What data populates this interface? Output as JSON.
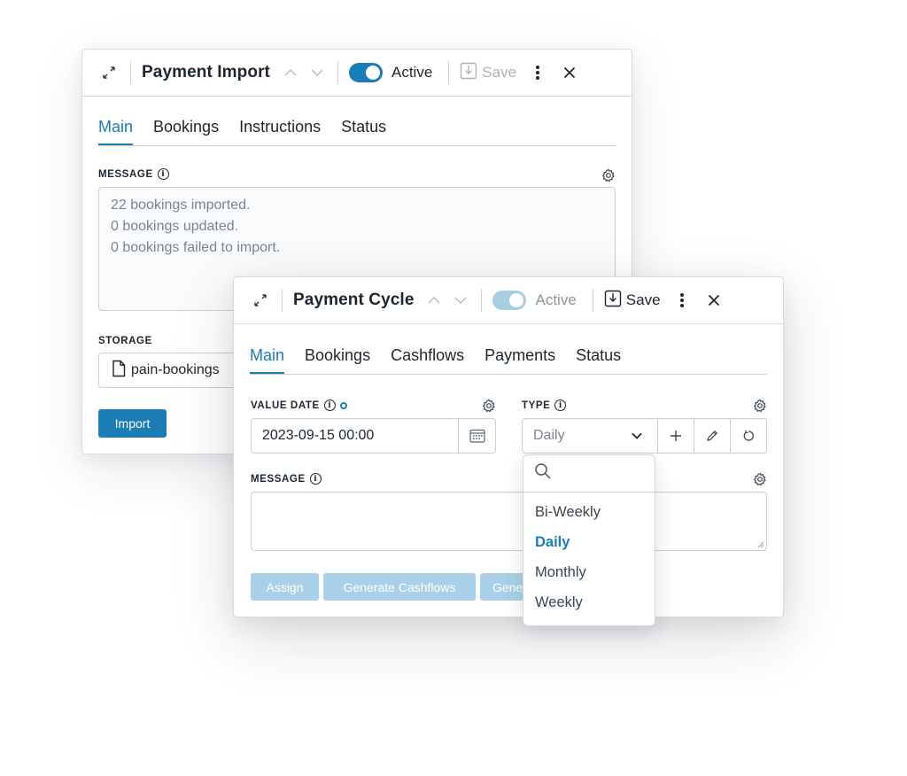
{
  "payment_import": {
    "title": "Payment Import",
    "active_label": "Active",
    "save_label": "Save",
    "tabs": [
      "Main",
      "Bookings",
      "Instructions",
      "Status"
    ],
    "message_label": "MESSAGE",
    "message_lines": [
      "22 bookings imported.",
      "0 bookings updated.",
      "0 bookings failed to import."
    ],
    "storage_label": "STORAGE",
    "storage_value": "pain-bookings",
    "import_button": "Import"
  },
  "payment_cycle": {
    "title": "Payment Cycle",
    "active_label": "Active",
    "save_label": "Save",
    "tabs": [
      "Main",
      "Bookings",
      "Cashflows",
      "Payments",
      "Status"
    ],
    "value_date_label": "VALUE DATE",
    "value_date": "2023-09-15 00:00",
    "type_label": "TYPE",
    "type_value": "Daily",
    "message_label": "MESSAGE",
    "message_value": "",
    "buttons": [
      "Assign",
      "Generate Cashflows",
      "Gene"
    ]
  },
  "type_dropdown": {
    "search_placeholder": "",
    "options": [
      "Bi-Weekly",
      "Daily",
      "Monthly",
      "Weekly"
    ],
    "selected": "Daily"
  },
  "colors": {
    "accent": "#1a7db5",
    "accent_muted": "#a9d0e6",
    "text": "#1c2630",
    "muted_text": "#7b848e",
    "border": "#c9ced4"
  }
}
